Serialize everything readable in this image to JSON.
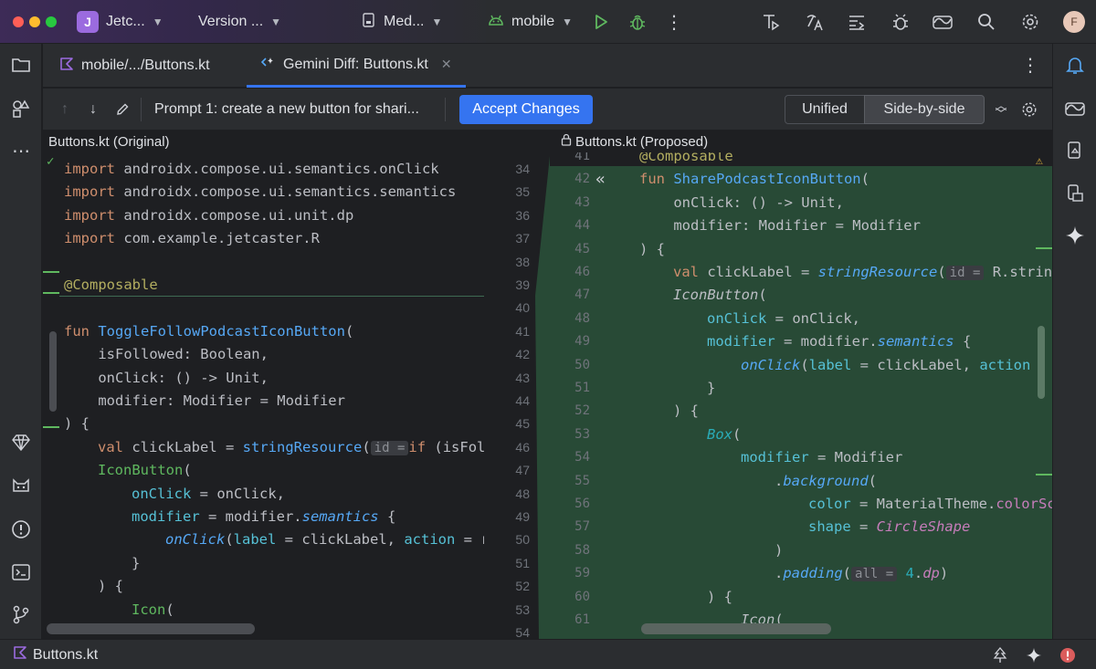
{
  "window": {
    "project_badge": "J",
    "project_name": "Jetc...",
    "vcs_label": "Version ...",
    "config_label": "Med...",
    "device_label": "mobile",
    "avatar_letter": "F"
  },
  "tabs": [
    {
      "label": "mobile/.../Buttons.kt"
    },
    {
      "label": "Gemini Diff: Buttons.kt"
    }
  ],
  "diff_toolbar": {
    "prompt": "Prompt 1: create a new button for shari...",
    "accept": "Accept Changes",
    "mode_unified": "Unified",
    "mode_side": "Side-by-side"
  },
  "panels": {
    "left_title": "Buttons.kt (Original)",
    "right_title": "Buttons.kt (Proposed)"
  },
  "gutter_numbers": [
    "34",
    "35",
    "36",
    "37",
    "38",
    "39",
    "40",
    "41",
    "42",
    "43",
    "44",
    "45",
    "46",
    "47",
    "48",
    "49",
    "50",
    "51",
    "52",
    "53",
    "54"
  ],
  "right_numbers": [
    "41",
    "42",
    "43",
    "44",
    "45",
    "46",
    "47",
    "48",
    "49",
    "50",
    "51",
    "52",
    "53",
    "54",
    "55",
    "56",
    "57",
    "58",
    "59",
    "60",
    "61"
  ],
  "left_code": {
    "l1": {
      "kw": "import",
      "rest": " androidx.compose.ui.semantics.onClick"
    },
    "l2": {
      "kw": "import",
      "rest": " androidx.compose.ui.semantics.semantics"
    },
    "l3": {
      "kw": "import",
      "rest": " androidx.compose.ui.unit.dp"
    },
    "l4": {
      "kw": "import",
      "rest": " com.example.jetcaster.R"
    },
    "l6": {
      "ann": "@Composable"
    },
    "l8": {
      "kw": "fun",
      "fn": "ToggleFollowPodcastIconButton",
      "rest": "("
    },
    "l9": "    isFollowed: Boolean,",
    "l10": "    onClick: () -> Unit,",
    "l11": "    modifier: Modifier = Modifier",
    "l12": ") {",
    "l13": {
      "kw": "val",
      "a": " clickLabel = ",
      "fn": "stringResource",
      "b": "(",
      "hint": "id =",
      "kw2": "if",
      "c": " (isFol"
    },
    "l14": {
      "fn": "IconButton",
      "rest": "("
    },
    "l15": {
      "named": "onClick",
      "rest": " = onClick,"
    },
    "l16": {
      "named": "modifier",
      "a": " = modifier.",
      "fn": "semantics",
      "b": " {"
    },
    "l17": {
      "fn": "onClick",
      "a": "(",
      "named": "label",
      "b": " = clickLabel, ",
      "named2": "action",
      "c": " = r"
    },
    "l18": "}",
    "l19": ") {",
    "l20": {
      "fn": "Icon",
      "rest": "("
    }
  },
  "right_code": {
    "r0": {
      "ann": "@Composable"
    },
    "r1": {
      "kw": "fun",
      "fn": "SharePodcastIconButton",
      "rest": "("
    },
    "r2": "    onClick: () -> Unit,",
    "r3": "    modifier: Modifier = Modifier",
    "r4": ") {",
    "r5": {
      "kw": "val",
      "a": " clickLabel = ",
      "fn": "stringResource",
      "b": "(",
      "hint": "id =",
      "c": " R.string."
    },
    "r6": {
      "fn": "IconButton",
      "rest": "("
    },
    "r7": {
      "named": "onClick",
      "rest": " = onClick,"
    },
    "r8": {
      "named": "modifier",
      "a": " = modifier.",
      "fn": "semantics",
      "b": " {"
    },
    "r9": {
      "fn": "onClick",
      "a": "(",
      "named": "label",
      "b": " = clickLabel, ",
      "named2": "action"
    },
    "r10": "}",
    "r11": ") {",
    "r12": {
      "fn": "Box",
      "rest": "("
    },
    "r13": {
      "named": "modifier",
      "rest": " = Modifier"
    },
    "r14": {
      "a": ".",
      "fn": "background",
      "b": "("
    },
    "r15": {
      "named": "color",
      "a": " = MaterialTheme.",
      "pink": "colorSc"
    },
    "r16": {
      "named": "shape",
      "a": " = ",
      "pink": "CircleShape"
    },
    "r17": ")",
    "r18": {
      "a": ".",
      "fn": "padding",
      "b": "(",
      "hint": "all =",
      "num": " 4",
      "c": ".",
      "pink": "dp",
      "d": ")"
    },
    "r19": ") {",
    "r20": {
      "fn": "Icon",
      "rest": "("
    }
  },
  "status": {
    "file": "Buttons.kt"
  }
}
